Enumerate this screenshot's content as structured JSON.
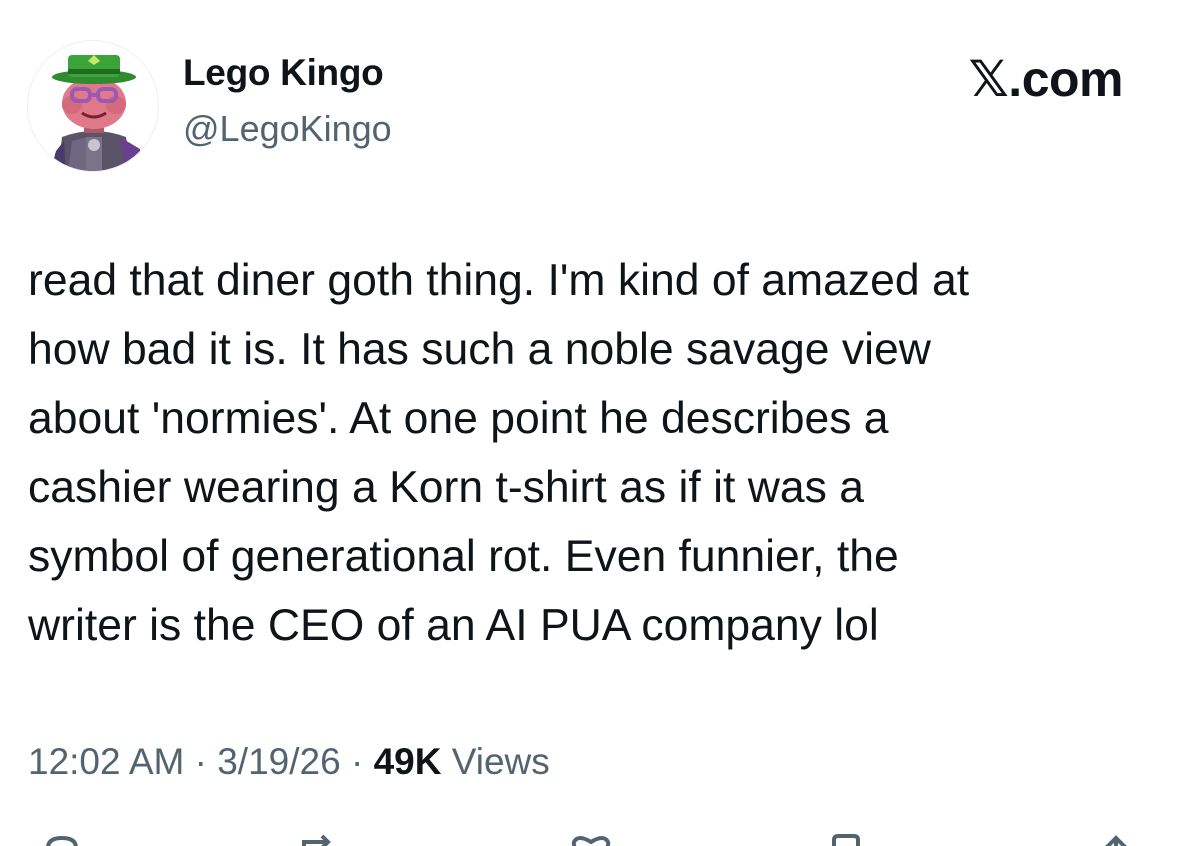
{
  "author": {
    "name": "Lego Kingo",
    "handle": "@LegoKingo",
    "avatar_icon": "lego-figure-avatar-icon"
  },
  "brand": {
    "x_glyph": "𝕏",
    "suffix": ".com"
  },
  "tweet": {
    "lines": [
      "read that diner goth thing. I'm kind of amazed at",
      "how bad it is. It has such a noble savage view",
      "about 'normies'. At one point he describes a",
      "cashier wearing a Korn t-shirt as if it was a",
      "symbol of generational rot. Even funnier, the",
      "writer is the CEO of an AI PUA company lol"
    ]
  },
  "meta": {
    "time": "12:02 AM",
    "separator": " · ",
    "date": "3/19/26",
    "views_count": "49K",
    "views_label": " Views"
  },
  "actions": [
    "reply-icon",
    "repost-icon",
    "like-icon",
    "bookmark-icon",
    "share-icon"
  ],
  "colors": {
    "text_primary": "#0f1419",
    "text_secondary": "#536471",
    "hat_green": "#2e8b2e",
    "face_pink": "#e07a8a",
    "glasses_purple": "#9b59b6"
  }
}
